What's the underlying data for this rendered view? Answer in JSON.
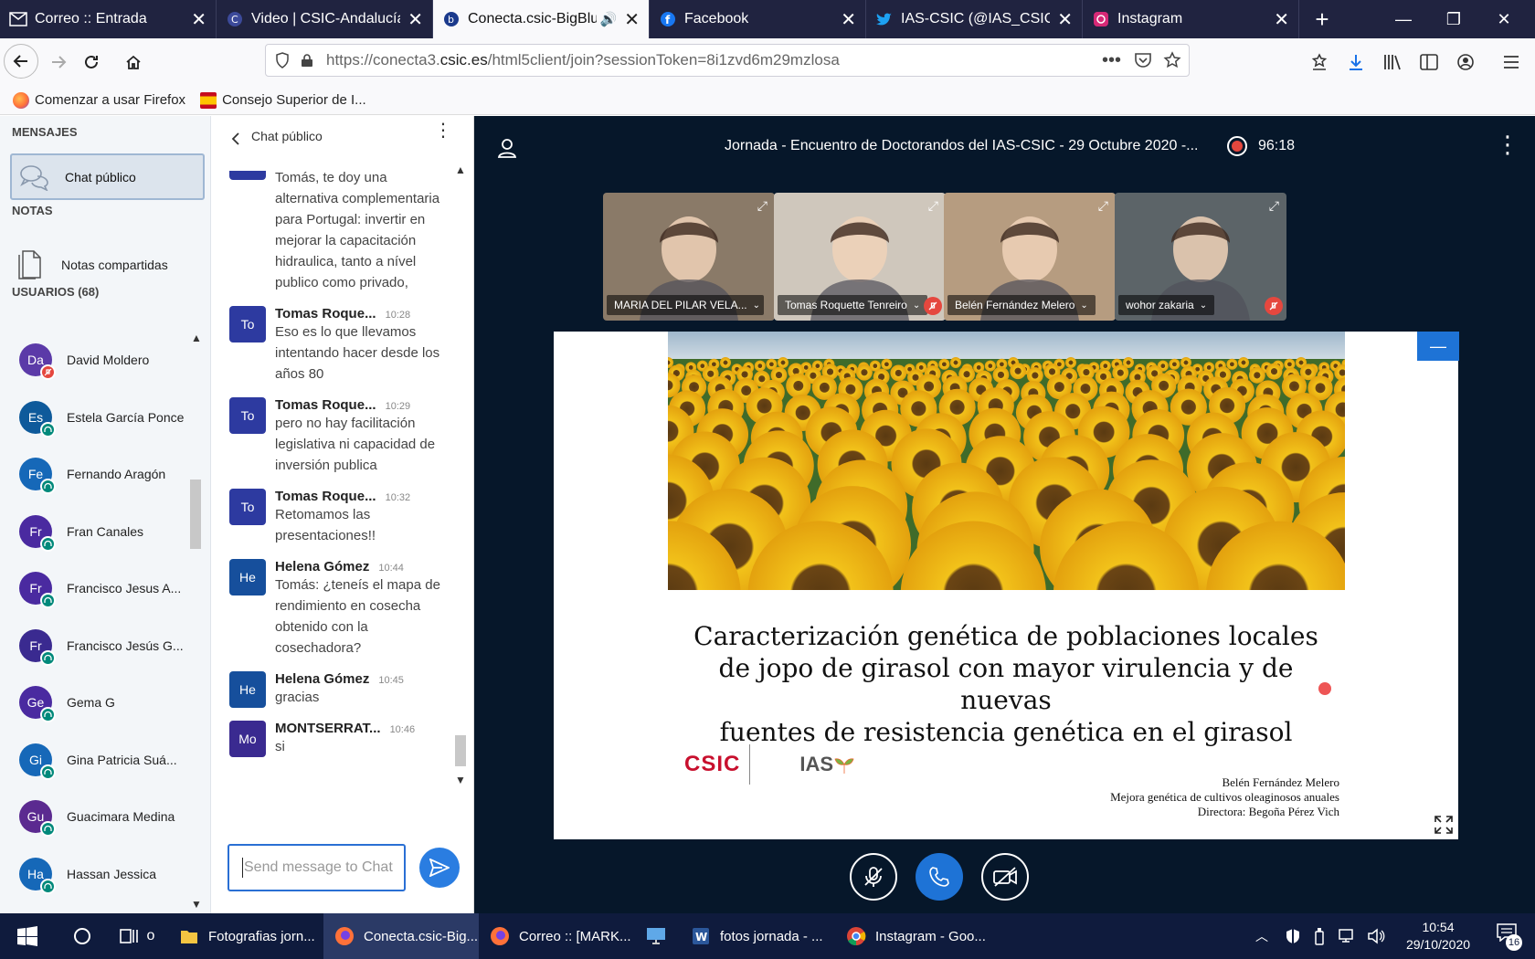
{
  "browser": {
    "tabs": [
      {
        "title": "Correo :: Entrada",
        "icon": "mail-icon",
        "active": false
      },
      {
        "title": "Video | CSIC-Andalucía",
        "icon": "csic-c-icon",
        "active": false
      },
      {
        "title": "Conecta.csic-BigBlue",
        "icon": "bigbluebutton-icon",
        "active": true
      },
      {
        "title": "Facebook",
        "icon": "facebook-icon",
        "active": false
      },
      {
        "title": "IAS-CSIC (@IAS_CSIC) / T",
        "icon": "twitter-icon",
        "active": false
      },
      {
        "title": "Instagram",
        "icon": "instagram-icon",
        "active": false
      }
    ],
    "url_prefix": "https://conecta3.",
    "url_domain": "csic.es",
    "url_path": "/html5client/join?sessionToken=8i1zvd6m29mzlosa",
    "bookmarks": [
      {
        "label": "Comenzar a usar Firefox",
        "icon": "firefox-icon"
      },
      {
        "label": "Consejo Superior de I...",
        "icon": "spain-coat-of-arms-icon"
      }
    ]
  },
  "sidebar": {
    "messages_heading": "MENSAJES",
    "public_chat_label": "Chat público",
    "notes_heading": "NOTAS",
    "shared_notes_label": "Notas compartidas",
    "users_heading": "USUARIOS (68)",
    "users": [
      {
        "initials": "Da",
        "name": "David Moldero",
        "color": "#5b3aa8",
        "status": "muted"
      },
      {
        "initials": "Es",
        "name": "Estela García Ponce",
        "color": "#0e5a9b",
        "status": "listen"
      },
      {
        "initials": "Fe",
        "name": "Fernando Aragón",
        "color": "#1668b8",
        "status": "listen"
      },
      {
        "initials": "Fr",
        "name": "Fran Canales",
        "color": "#4a2aa0",
        "status": "listen"
      },
      {
        "initials": "Fr",
        "name": "Francisco Jesus A...",
        "color": "#4a2aa0",
        "status": "listen"
      },
      {
        "initials": "Fr",
        "name": "Francisco Jesús G...",
        "color": "#3a2a90",
        "status": "listen"
      },
      {
        "initials": "Ge",
        "name": "Gema G",
        "color": "#4a2aa0",
        "status": "listen"
      },
      {
        "initials": "Gi",
        "name": "Gina Patricia Suá...",
        "color": "#1668b8",
        "status": "listen"
      },
      {
        "initials": "Gu",
        "name": "Guacimara Medina",
        "color": "#5b2a90",
        "status": "listen"
      },
      {
        "initials": "Ha",
        "name": "Hassan Jessica",
        "color": "#1668b8",
        "status": "listen"
      }
    ]
  },
  "chat": {
    "title": "Chat público",
    "partial_message": "Tomás, te doy una alternativa complementaria para Portugal: invertir en mejorar la capacitación hidraulica, tanto a nível publico como privado,",
    "messages": [
      {
        "initials": "To",
        "color": "#2d3aa0",
        "name": "Tomas Roque...",
        "time": "10:28",
        "text": "Eso es lo que llevamos intentando hacer desde los años 80"
      },
      {
        "initials": "To",
        "color": "#2d3aa0",
        "name": "Tomas Roque...",
        "time": "10:29",
        "text": "pero no hay facilitación legislativa ni capacidad de inversión publica"
      },
      {
        "initials": "To",
        "color": "#2d3aa0",
        "name": "Tomas Roque...",
        "time": "10:32",
        "text": "Retomamos las presentaciones!!"
      },
      {
        "initials": "He",
        "color": "#164f9c",
        "name": "Helena Gómez",
        "time": "10:44",
        "text": "Tomás: ¿teneís el mapa de rendimiento en cosecha obtenido con la cosechadora?"
      },
      {
        "initials": "He",
        "color": "#164f9c",
        "name": "Helena Gómez",
        "time": "10:45",
        "text": "gracias"
      },
      {
        "initials": "Mo",
        "color": "#3a2a90",
        "name": "MONTSERRAT...",
        "time": "10:46",
        "text": "si"
      }
    ],
    "input_placeholder": "Send message to Chat"
  },
  "meeting": {
    "title": "Jornada - Encuentro de Doctorandos del IAS-CSIC - 29 Octubre 2020 -...",
    "recording_time": "96:18",
    "videos": [
      {
        "name": "MARIA DEL PILAR VELA...",
        "muted": false,
        "bg": "#8a7a68"
      },
      {
        "name": "Tomas Roquette Tenreiro",
        "muted": true,
        "bg": "#cfc7bc"
      },
      {
        "name": "Belén Fernández Melero",
        "muted": false,
        "bg": "#b69c80"
      },
      {
        "name": "wohor zakaria",
        "muted": true,
        "bg": "#5c6468"
      }
    ],
    "slide": {
      "title_lines": [
        "Caracterización genética de poblaciones locales",
        "de jopo de girasol con mayor virulencia y de nuevas",
        "fuentes de resistencia genética en el girasol"
      ],
      "logo_csic": "CSIC",
      "logo_ias": "IAS",
      "credits": [
        "Belén Fernández Melero",
        "Mejora genética de cultivos oleaginosos anuales",
        "Directora:  Begoña Pérez Vich"
      ]
    }
  },
  "taskbar": {
    "items": [
      {
        "label": "Fotografias jorn...",
        "icon": "folder-icon",
        "active": false
      },
      {
        "label": "Conecta.csic-Big...",
        "icon": "firefox-icon",
        "active": true
      },
      {
        "label": "Correo :: [MARK...",
        "icon": "firefox-icon",
        "active": false
      },
      {
        "label": "",
        "icon": "computer-icon",
        "active": false
      },
      {
        "label": "fotos jornada - ...",
        "icon": "word-icon",
        "active": false
      },
      {
        "label": "Instagram - Goo...",
        "icon": "chrome-icon",
        "active": false
      }
    ],
    "search_label": "o",
    "clock_time": "10:54",
    "clock_date": "29/10/2020",
    "notification_count": "16"
  },
  "colors": {
    "accent": "#2a7de1",
    "meeting_bg": "#06172a",
    "record_red": "#e5473e"
  }
}
